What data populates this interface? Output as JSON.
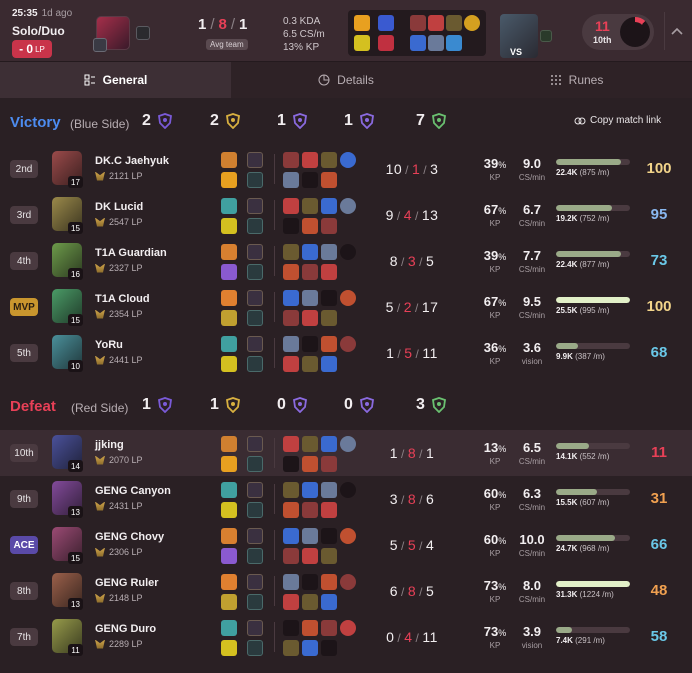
{
  "summary": {
    "time": "25:35",
    "ago": "1d ago",
    "queue": "Solo/Duo",
    "lp_change": "- 0",
    "lp_unit": "LP",
    "kda": {
      "k": "1",
      "d": "8",
      "a": "1"
    },
    "avg_team": "Avg team",
    "kda_ratio": "0.3 KDA",
    "cs_per_min": "6.5 CS/m",
    "kp": "13% KP",
    "vs_label": "VS",
    "rank": "11",
    "rank_suffix": "10th",
    "rank_ring_fraction": 0.12
  },
  "tabs": [
    {
      "label": "General",
      "icon": "list-icon"
    },
    {
      "label": "Details",
      "icon": "pie-chart-icon"
    },
    {
      "label": "Runes",
      "icon": "grid-icon"
    }
  ],
  "copy_link": "Copy match link",
  "colors": {
    "victory": "#4d8cf0",
    "defeat": "#e84057",
    "death": "#e84057",
    "mvp": "#c9962e",
    "ace": "#5a4aa8"
  },
  "teams": [
    {
      "result": "Victory",
      "side": "(Blue Side)",
      "objectives": [
        {
          "icon": "baron-icon",
          "value": "2"
        },
        {
          "icon": "dragon-icon",
          "value": "2"
        },
        {
          "icon": "herald-icon",
          "value": "1"
        },
        {
          "icon": "grub-icon",
          "value": "1"
        },
        {
          "icon": "tower-icon",
          "value": "7"
        }
      ],
      "players": [
        {
          "place": "2nd",
          "name": "DK.C Jaehyuk",
          "lp": "2121 LP",
          "level": "17",
          "k": "10",
          "d": "1",
          "a": "3",
          "kp": "39",
          "cs": "9.0",
          "cs_label": "CS/min",
          "dmg": "22.4K",
          "dmg_per": "(875 /m)",
          "dmg_frac": 0.875,
          "score": "100",
          "score_color": "#f2d48a"
        },
        {
          "place": "3rd",
          "name": "DK Lucid",
          "lp": "2547 LP",
          "level": "15",
          "k": "9",
          "d": "4",
          "a": "13",
          "kp": "67",
          "cs": "6.7",
          "cs_label": "CS/min",
          "dmg": "19.2K",
          "dmg_per": "(752 /m)",
          "dmg_frac": 0.752,
          "score": "95",
          "score_color": "#8ab8f0"
        },
        {
          "place": "4th",
          "name": "T1A Guardian",
          "lp": "2327 LP",
          "level": "16",
          "k": "8",
          "d": "3",
          "a": "5",
          "kp": "39",
          "cs": "7.7",
          "cs_label": "CS/min",
          "dmg": "22.4K",
          "dmg_per": "(877 /m)",
          "dmg_frac": 0.877,
          "score": "73",
          "score_color": "#6ac8e8"
        },
        {
          "place": "MVP",
          "name": "T1A Cloud",
          "lp": "2354 LP",
          "level": "15",
          "k": "5",
          "d": "2",
          "a": "17",
          "kp": "67",
          "cs": "9.5",
          "cs_label": "CS/min",
          "dmg": "25.5K",
          "dmg_per": "(995 /m)",
          "dmg_frac": 1.0,
          "top": true,
          "score": "100",
          "score_color": "#f2d48a"
        },
        {
          "place": "5th",
          "name": "YoRu",
          "lp": "2441 LP",
          "level": "10",
          "k": "1",
          "d": "5",
          "a": "11",
          "kp": "36",
          "cs": "3.6",
          "cs_label": "vision",
          "dmg": "9.9K",
          "dmg_per": "(387 /m)",
          "dmg_frac": 0.3,
          "score": "68",
          "score_color": "#6ac8e8"
        }
      ]
    },
    {
      "result": "Defeat",
      "side": "(Red Side)",
      "objectives": [
        {
          "icon": "baron-icon",
          "value": "1"
        },
        {
          "icon": "dragon-icon",
          "value": "1"
        },
        {
          "icon": "herald-icon",
          "value": "0"
        },
        {
          "icon": "grub-icon",
          "value": "0"
        },
        {
          "icon": "tower-icon",
          "value": "3"
        }
      ],
      "players": [
        {
          "place": "10th",
          "name": "jjking",
          "lp": "2070 LP",
          "level": "14",
          "k": "1",
          "d": "8",
          "a": "1",
          "kp": "13",
          "cs": "6.5",
          "cs_label": "CS/min",
          "dmg": "14.1K",
          "dmg_per": "(552 /m)",
          "dmg_frac": 0.45,
          "score": "11",
          "score_color": "#e84057",
          "highlight": true
        },
        {
          "place": "9th",
          "name": "GENG Canyon",
          "lp": "2431 LP",
          "level": "13",
          "k": "3",
          "d": "8",
          "a": "6",
          "kp": "60",
          "cs": "6.3",
          "cs_label": "CS/min",
          "dmg": "15.5K",
          "dmg_per": "(607 /m)",
          "dmg_frac": 0.55,
          "score": "31",
          "score_color": "#f0a050"
        },
        {
          "place": "ACE",
          "name": "GENG Chovy",
          "lp": "2306 LP",
          "level": "15",
          "k": "5",
          "d": "5",
          "a": "4",
          "kp": "60",
          "cs": "10.0",
          "cs_label": "CS/min",
          "dmg": "24.7K",
          "dmg_per": "(968 /m)",
          "dmg_frac": 0.8,
          "score": "66",
          "score_color": "#6ac8e8"
        },
        {
          "place": "8th",
          "name": "GENG Ruler",
          "lp": "2148 LP",
          "level": "13",
          "k": "6",
          "d": "8",
          "a": "5",
          "kp": "73",
          "cs": "8.0",
          "cs_label": "CS/min",
          "dmg": "31.3K",
          "dmg_per": "(1224 /m)",
          "dmg_frac": 1.0,
          "top": true,
          "score": "48",
          "score_color": "#f0a050"
        },
        {
          "place": "7th",
          "name": "GENG Duro",
          "lp": "2289 LP",
          "level": "11",
          "k": "0",
          "d": "4",
          "a": "11",
          "kp": "73",
          "cs": "3.9",
          "cs_label": "vision",
          "dmg": "7.4K",
          "dmg_per": "(291 /m)",
          "dmg_frac": 0.22,
          "score": "58",
          "score_color": "#6ac8e8"
        }
      ]
    }
  ]
}
